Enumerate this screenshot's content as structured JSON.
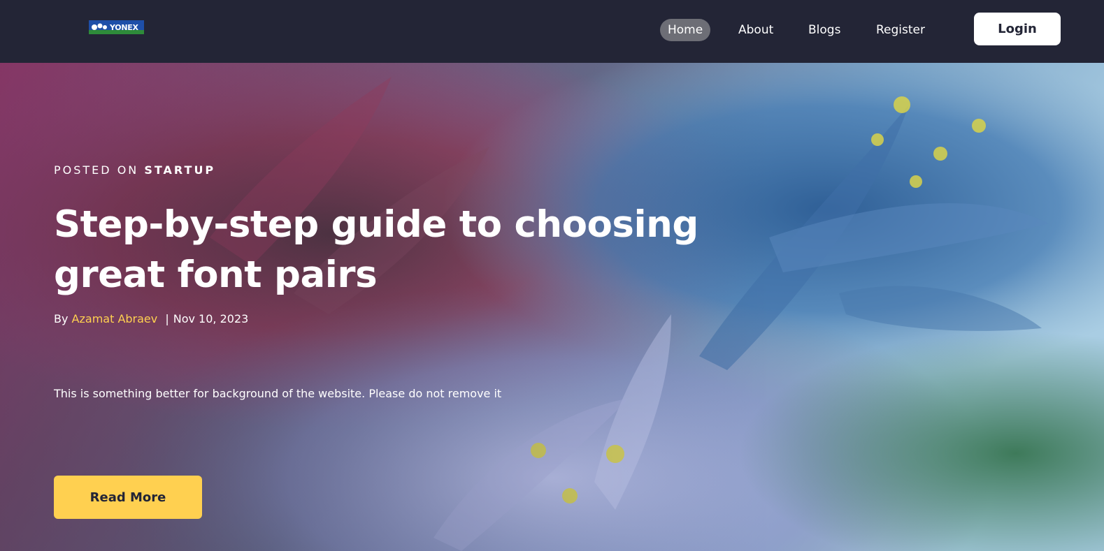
{
  "brand": {
    "logo_text": "YONEX",
    "logo_icon": "yonex-logo-icon"
  },
  "nav": {
    "items": [
      {
        "label": "Home",
        "active": true
      },
      {
        "label": "About",
        "active": false
      },
      {
        "label": "Blogs",
        "active": false
      },
      {
        "label": "Register",
        "active": false
      }
    ],
    "login_label": "Login"
  },
  "hero": {
    "posted_prefix": "POSTED ON",
    "category": "STARTUP",
    "title": "Step-by-step guide to choosing great font pairs",
    "by_prefix": "By",
    "author": "Azamat Abraev",
    "separator": "|",
    "date": "Nov 10, 2023",
    "description": "This is something better for background of the website. Please do not remove it",
    "cta_label": "Read More"
  },
  "colors": {
    "header_bg": "#232536",
    "accent_yellow": "#ffd050",
    "active_nav_bg": "#6d6e76",
    "text_white": "#ffffff"
  }
}
